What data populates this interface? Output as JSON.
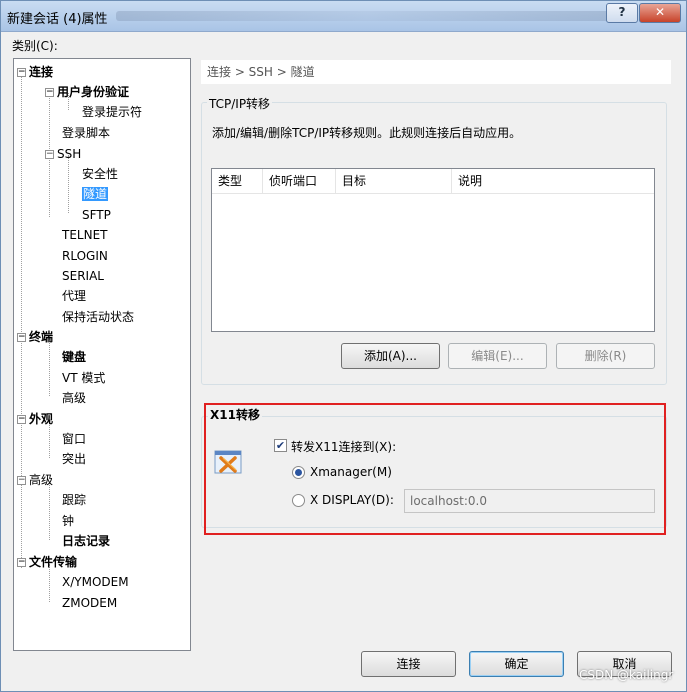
{
  "window": {
    "title": "新建会话 (4)属性",
    "help_label": "?",
    "close_label": "✕"
  },
  "category_label": "类别(C):",
  "tree": {
    "items": [
      {
        "label": "连接"
      },
      {
        "label": "用户身份验证"
      },
      {
        "label": "登录提示符"
      },
      {
        "label": "登录脚本"
      },
      {
        "label": "SSH"
      },
      {
        "label": "安全性"
      },
      {
        "label": "隧道"
      },
      {
        "label": "SFTP"
      },
      {
        "label": "TELNET"
      },
      {
        "label": "RLOGIN"
      },
      {
        "label": "SERIAL"
      },
      {
        "label": "代理"
      },
      {
        "label": "保持活动状态"
      },
      {
        "label": "终端"
      },
      {
        "label": "键盘"
      },
      {
        "label": "VT 模式"
      },
      {
        "label": "高级"
      },
      {
        "label": "外观"
      },
      {
        "label": "窗口"
      },
      {
        "label": "突出"
      },
      {
        "label": "高级"
      },
      {
        "label": "跟踪"
      },
      {
        "label": "钟"
      },
      {
        "label": "日志记录"
      },
      {
        "label": "文件传输"
      },
      {
        "label": "X/YMODEM"
      },
      {
        "label": "ZMODEM"
      }
    ]
  },
  "breadcrumb": "连接 > SSH > 隧道",
  "tcpip": {
    "group_title": "TCP/IP转移",
    "description": "添加/编辑/删除TCP/IP转移规则。此规则连接后自动应用。",
    "columns": [
      "类型",
      "侦听端口",
      "目标",
      "说明"
    ],
    "add_label": "添加(A)...",
    "edit_label": "编辑(E)...",
    "delete_label": "删除(R)"
  },
  "x11": {
    "group_title": "X11转移",
    "forward_label": "转发X11连接到(X):",
    "forward_checked": true,
    "xmanager_label": "Xmanager(M)",
    "xdisplay_label": "X DISPLAY(D):",
    "xdisplay_value": "localhost:0.0"
  },
  "footer": {
    "connect_label": "连接",
    "ok_label": "确定",
    "cancel_label": "取消"
  },
  "watermark": "CSDN @kailingr"
}
